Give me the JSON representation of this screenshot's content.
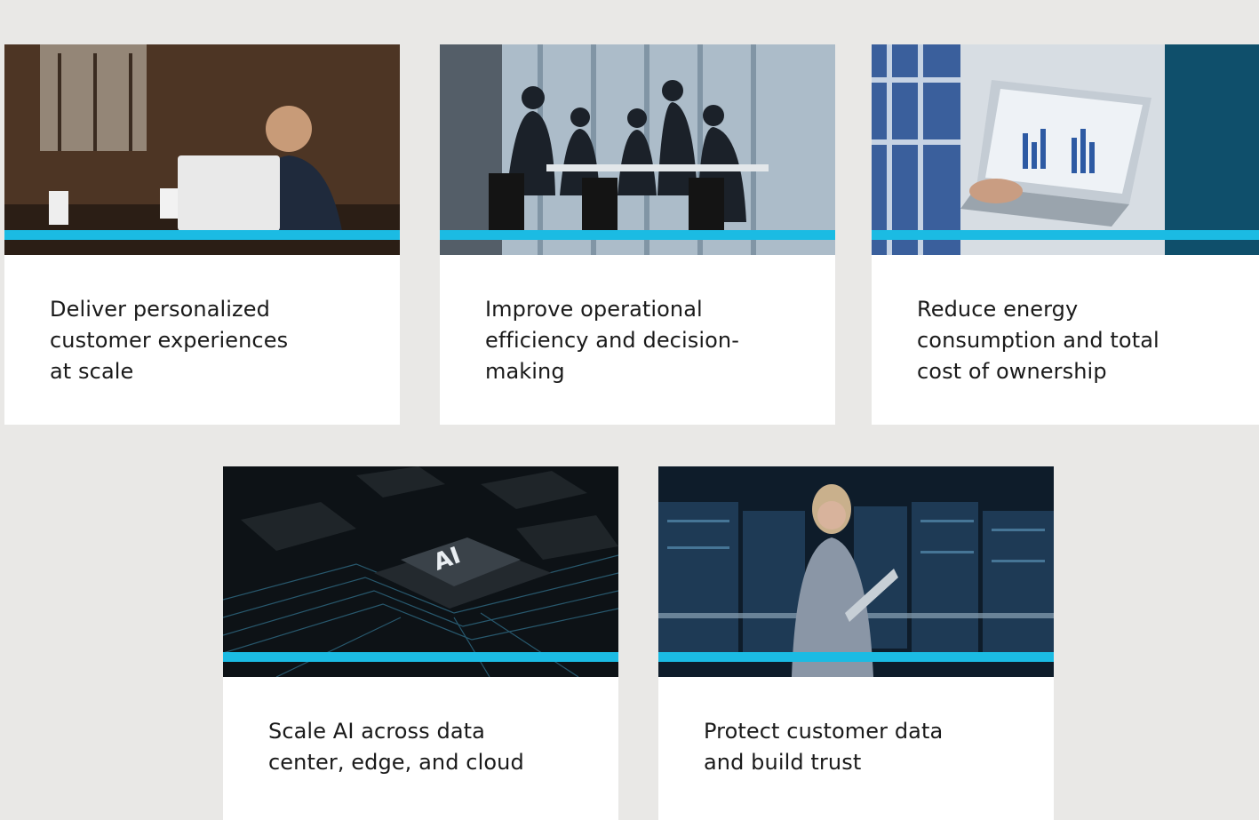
{
  "cards": [
    {
      "image": "person-working-on-laptop-in-cafe",
      "title": "Deliver personalized customer experiences at scale"
    },
    {
      "image": "team-meeting-in-glass-office",
      "title": "Improve operational efficiency and decision-making"
    },
    {
      "image": "laptop-showing-charts",
      "title": "Reduce energy consumption and total cost of ownership"
    },
    {
      "image": "ai-chip-on-circuit-board",
      "title": "Scale AI across data center, edge, and cloud"
    },
    {
      "image": "woman-with-laptop-in-server-room",
      "title": "Protect customer data and build trust"
    }
  ],
  "colors": {
    "accent": "#1bbbe3",
    "background": "#e9e8e6",
    "card": "#ffffff",
    "text": "#1a1a1a"
  }
}
